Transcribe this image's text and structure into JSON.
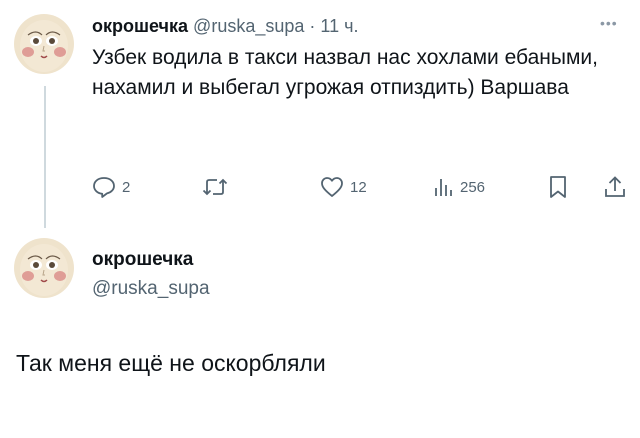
{
  "tweet": {
    "author_name": "окрошечка",
    "author_handle": "@ruska_supa",
    "separator": "·",
    "time": "11 ч.",
    "text": "Узбек водила в такси назвал нас хохлами ебаными, нахамил и выбегал угрожая отпиздить) Варшава",
    "more_icon": "more-dots-icon",
    "actions": {
      "replies": "2",
      "retweets": "",
      "likes": "12",
      "views": "256"
    }
  },
  "reply": {
    "author_name": "окрошечка",
    "author_handle": "@ruska_supa",
    "text": "Так меня ещё не оскорбляли"
  },
  "colors": {
    "text_primary": "#0f1419",
    "text_secondary": "#536471",
    "thread_line": "#cfd9de",
    "avatar_bg": "#efe3cc",
    "cheek": "#d98a86"
  }
}
